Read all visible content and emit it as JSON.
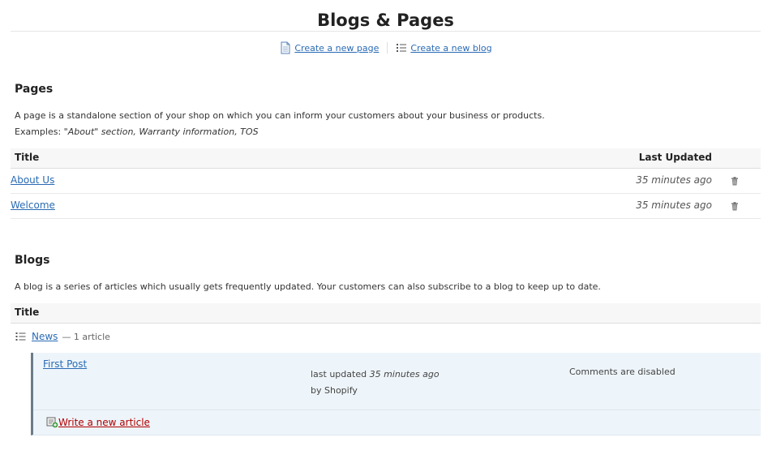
{
  "header": {
    "title": "Blogs & Pages",
    "create_page_label": "Create a new page",
    "create_blog_label": "Create a new blog"
  },
  "pages": {
    "heading": "Pages",
    "description": "A page is a standalone section of your shop on which you can inform your customers about your business or products.",
    "examples_label": "Examples:",
    "examples_text": "\"About\" section, Warranty information, TOS",
    "col_title": "Title",
    "col_updated": "Last Updated",
    "rows": [
      {
        "title": "About Us",
        "updated": "35 minutes ago"
      },
      {
        "title": "Welcome",
        "updated": "35 minutes ago"
      }
    ]
  },
  "blogs": {
    "heading": "Blogs",
    "description": "A blog is a series of articles which usually gets frequently updated. Your customers can also subscribe to a blog to keep up to date.",
    "col_title": "Title",
    "items": [
      {
        "name": "News",
        "count": "— 1 article",
        "article": {
          "title": "First Post",
          "updated_prefix": "last updated",
          "updated": "35 minutes ago",
          "by": "by Shopify",
          "comments": "Comments are disabled"
        },
        "write_label": "Write a new article"
      }
    ]
  },
  "colors": {
    "link": "#2a6bb5",
    "write_link": "#b00000",
    "article_bg": "#eef5fa"
  }
}
